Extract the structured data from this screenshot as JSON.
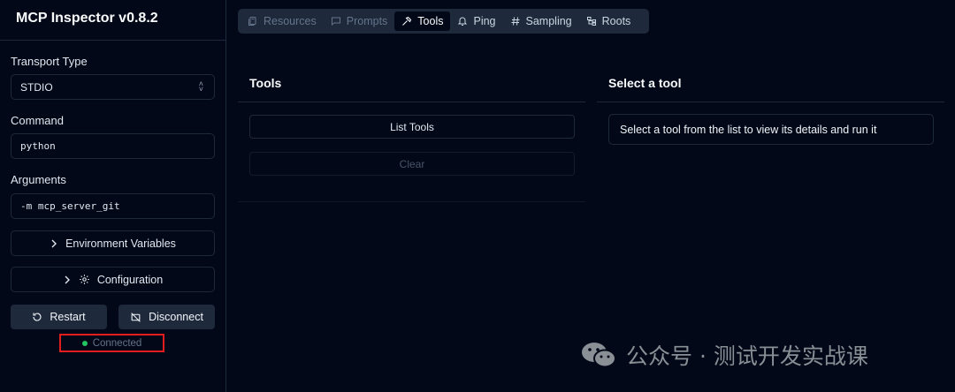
{
  "app": {
    "title": "MCP Inspector v0.8.2"
  },
  "sidebar": {
    "transport_label": "Transport Type",
    "transport_value": "STDIO",
    "command_label": "Command",
    "command_value": "python",
    "arguments_label": "Arguments",
    "arguments_value": "-m mcp_server_git",
    "env_vars_label": "Environment Variables",
    "configuration_label": "Configuration",
    "restart_label": "Restart",
    "disconnect_label": "Disconnect",
    "status_text": "Connected",
    "status_color": "#22c55e"
  },
  "tabs": [
    {
      "label": "Resources",
      "icon": "file-icon"
    },
    {
      "label": "Prompts",
      "icon": "message-icon"
    },
    {
      "label": "Tools",
      "icon": "hammer-icon",
      "active": true
    },
    {
      "label": "Ping",
      "icon": "bell-icon"
    },
    {
      "label": "Sampling",
      "icon": "hash-icon"
    },
    {
      "label": "Roots",
      "icon": "folder-tree-icon"
    }
  ],
  "tools_panel": {
    "title": "Tools",
    "list_button": "List Tools",
    "clear_button": "Clear"
  },
  "detail_panel": {
    "title": "Select a tool",
    "message": "Select a tool from the list to view its details and run it"
  },
  "watermark": {
    "text": "公众号 · 测试开发实战课"
  },
  "colors": {
    "background": "#020817",
    "border": "#1e293b",
    "highlight_box": "#e11d1d"
  }
}
